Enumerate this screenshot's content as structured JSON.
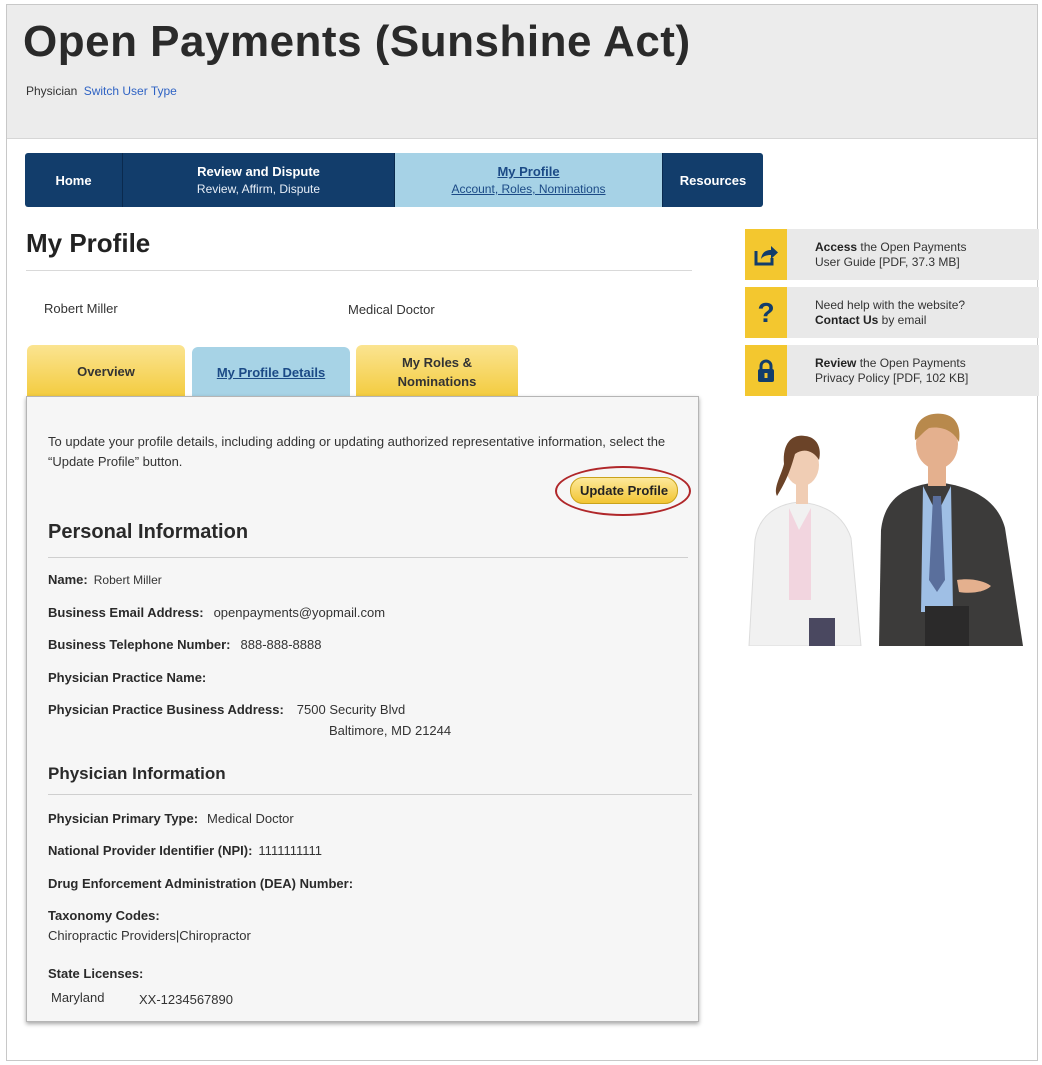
{
  "header": {
    "title": "Open Payments (Sunshine Act)",
    "user_type": "Physician",
    "switch_link": "Switch User Type"
  },
  "nav": {
    "home": "Home",
    "review_title": "Review and Dispute",
    "review_sub": "Review, Affirm, Dispute",
    "profile_title": "My Profile",
    "profile_sub": "Account, Roles, Nominations",
    "resources": "Resources"
  },
  "page": {
    "title": "My Profile",
    "user_name": "Robert Miller",
    "user_type": "Medical Doctor"
  },
  "tabs": {
    "overview": "Overview",
    "details": "My Profile Details",
    "roles_line1": "My Roles &",
    "roles_line2": "Nominations"
  },
  "panel": {
    "intro": "To update your profile details, including adding or updating authorized representative information, select the “Update Profile” button.",
    "update_button": "Update Profile",
    "personal_heading": "Personal Information",
    "name_label": "Name:",
    "name_value": "Robert Miller",
    "email_label": "Business Email Address:",
    "email_value": "openpayments@yopmail.com",
    "phone_label": "Business Telephone Number:",
    "phone_value": "888-888-8888",
    "practice_name_label": "Physician Practice Name:",
    "address_label": "Physician Practice Business Address:",
    "address_line1": "7500 Security Blvd",
    "address_line2": "Baltimore, MD 21244",
    "physician_heading": "Physician Information",
    "primary_type_label": "Physician Primary Type:",
    "primary_type_value": "Medical Doctor",
    "npi_label": "National Provider Identifier (NPI):",
    "npi_value": "1111111111",
    "dea_label": "Drug Enforcement Administration (DEA) Number:",
    "taxonomy_label": "Taxonomy Codes:",
    "taxonomy_value": "Chiropractic Providers|Chiropractor",
    "licenses_label": "State Licenses:",
    "license_state": "Maryland",
    "license_number": "XX-1234567890"
  },
  "sidebar": {
    "guide_bold": "Access",
    "guide_rest": " the Open Payments",
    "guide_line2": "User Guide [PDF, 37.3 MB]",
    "help_line1": "Need help with the website?",
    "help_bold": "Contact Us",
    "help_rest": " by email",
    "privacy_bold": "Review",
    "privacy_rest": " the Open Payments",
    "privacy_line2": "Privacy Policy [PDF, 102 KB]"
  },
  "colors": {
    "nav_dark": "#123d6b",
    "nav_active": "#a6d2e6",
    "tab_yellow": "#f3cb3d",
    "highlight_ring": "#b0272a"
  }
}
